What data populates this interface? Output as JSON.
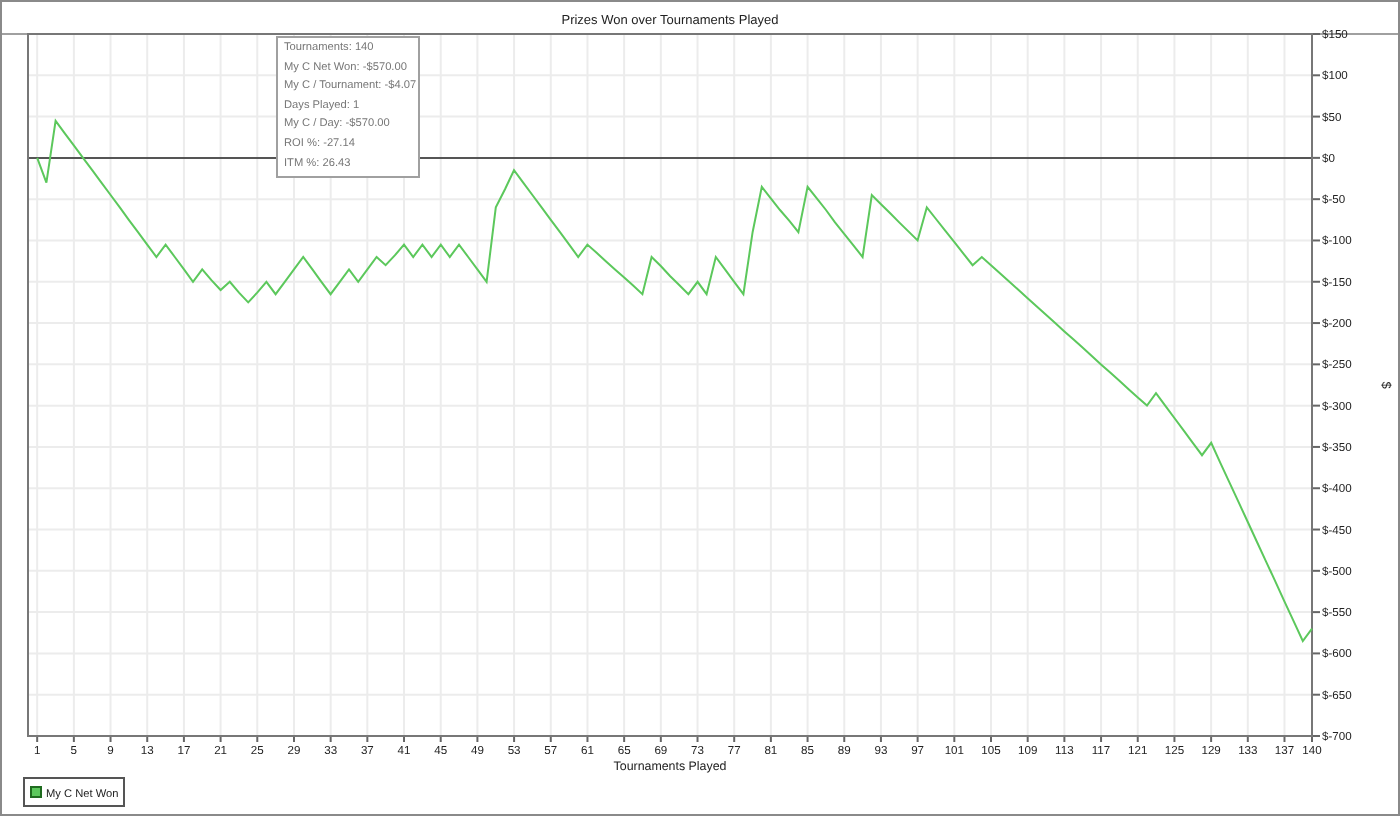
{
  "chart": {
    "chart_data": {
      "type": "line",
      "title": "Prizes Won over Tournaments Played",
      "xlabel": "Tournaments Played",
      "ylabel": "$",
      "x": [
        1,
        2,
        3,
        4,
        5,
        6,
        7,
        8,
        9,
        10,
        11,
        12,
        13,
        14,
        15,
        16,
        17,
        18,
        19,
        20,
        21,
        22,
        23,
        24,
        25,
        26,
        27,
        28,
        29,
        30,
        31,
        32,
        33,
        34,
        35,
        36,
        37,
        38,
        39,
        40,
        41,
        42,
        43,
        44,
        45,
        46,
        47,
        48,
        49,
        50,
        51,
        52,
        53,
        54,
        55,
        56,
        57,
        58,
        59,
        60,
        61,
        62,
        63,
        64,
        65,
        66,
        67,
        68,
        69,
        70,
        71,
        72,
        73,
        74,
        75,
        76,
        77,
        78,
        79,
        80,
        81,
        82,
        83,
        84,
        85,
        86,
        87,
        88,
        89,
        90,
        91,
        92,
        93,
        94,
        95,
        96,
        97,
        98,
        99,
        100,
        101,
        102,
        103,
        104,
        105,
        106,
        107,
        108,
        109,
        110,
        111,
        112,
        113,
        114,
        115,
        116,
        117,
        118,
        119,
        120,
        121,
        122,
        123,
        124,
        125,
        126,
        127,
        128,
        129,
        130,
        131,
        132,
        133,
        134,
        135,
        136,
        137,
        138,
        139,
        140
      ],
      "series": [
        {
          "name": "My C Net Won",
          "color": "#5cc85c",
          "values": [
            0,
            -30,
            45,
            30,
            15,
            0,
            -15,
            -30,
            -45,
            -60,
            -75,
            -90,
            -105,
            -120,
            -105,
            -120,
            -135,
            -150,
            -135,
            -148,
            -160,
            -150,
            -163,
            -175,
            -163,
            -150,
            -165,
            -150,
            -135,
            -120,
            -135,
            -150,
            -165,
            -150,
            -135,
            -150,
            -135,
            -120,
            -130,
            -118,
            -105,
            -120,
            -105,
            -120,
            -105,
            -120,
            -105,
            -120,
            -135,
            -150,
            -60,
            -38,
            -15,
            -30,
            -45,
            -60,
            -75,
            -90,
            -105,
            -120,
            -105,
            -115,
            -125,
            -135,
            -145,
            -155,
            -165,
            -120,
            -131,
            -143,
            -154,
            -165,
            -150,
            -165,
            -120,
            -135,
            -150,
            -165,
            -90,
            -35,
            -49,
            -63,
            -76,
            -90,
            -35,
            -49,
            -63,
            -78,
            -92,
            -106,
            -120,
            -45,
            -56,
            -67,
            -78,
            -89,
            -100,
            -60,
            -74,
            -88,
            -102,
            -116,
            -130,
            -120,
            -130,
            -140,
            -150,
            -160,
            -170,
            -180,
            -190,
            -200,
            -210,
            -220,
            -230,
            -240,
            -250,
            -260,
            -270,
            -280,
            -290,
            -300,
            -285,
            -300,
            -315,
            -330,
            -345,
            -360,
            -345,
            -369,
            -393,
            -417,
            -441,
            -465,
            -489,
            -513,
            -537,
            -561,
            -585,
            -570
          ]
        }
      ],
      "grid": true,
      "xlim": [
        0,
        140
      ],
      "ylim": [
        -700,
        150
      ],
      "xticks": [
        1,
        5,
        9,
        13,
        17,
        21,
        25,
        29,
        33,
        37,
        41,
        45,
        49,
        53,
        57,
        61,
        65,
        69,
        73,
        77,
        81,
        85,
        89,
        93,
        97,
        101,
        105,
        109,
        113,
        117,
        121,
        125,
        129,
        133,
        137,
        140
      ],
      "yticks": [
        {
          "value": 150,
          "label": "$150"
        },
        {
          "value": 100,
          "label": "$100"
        },
        {
          "value": 50,
          "label": "$50"
        },
        {
          "value": 0,
          "label": "$0"
        },
        {
          "value": -50,
          "label": "$-50"
        },
        {
          "value": -100,
          "label": "$-100"
        },
        {
          "value": -150,
          "label": "$-150"
        },
        {
          "value": -200,
          "label": "$-200"
        },
        {
          "value": -250,
          "label": "$-250"
        },
        {
          "value": -300,
          "label": "$-300"
        },
        {
          "value": -350,
          "label": "$-350"
        },
        {
          "value": -400,
          "label": "$-400"
        },
        {
          "value": -450,
          "label": "$-450"
        },
        {
          "value": -500,
          "label": "$-500"
        },
        {
          "value": -550,
          "label": "$-550"
        },
        {
          "value": -600,
          "label": "$-600"
        },
        {
          "value": -650,
          "label": "$-650"
        },
        {
          "value": -700,
          "label": "$-700"
        }
      ]
    }
  },
  "tooltip": {
    "lines": [
      "Tournaments: 140",
      "My C Net Won: -$570.00",
      "My C / Tournament: -$4.07",
      "Days Played: 1",
      "My C / Day: -$570.00",
      "ROI %: -27.14",
      "ITM %: 26.43"
    ]
  },
  "legend": {
    "shown": true
  }
}
